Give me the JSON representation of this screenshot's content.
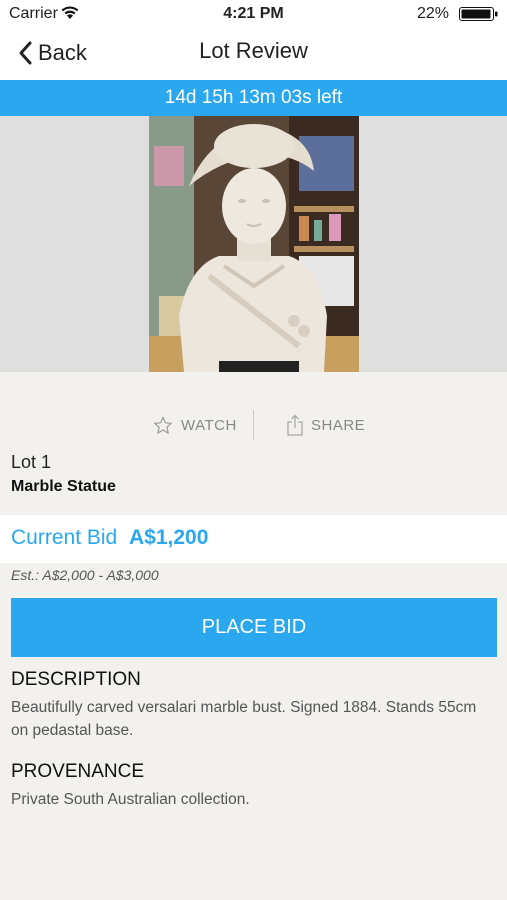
{
  "status_bar": {
    "carrier": "Carrier",
    "time": "4:21 PM",
    "battery": "22%"
  },
  "nav": {
    "back_label": "Back",
    "title": "Lot Review"
  },
  "timer": {
    "text": "14d 15h 13m 03s left"
  },
  "actions": {
    "watch_label": "WATCH",
    "share_label": "SHARE"
  },
  "lot": {
    "number": "Lot 1",
    "name": "Marble Statue"
  },
  "bid": {
    "label": "Current Bid",
    "amount": "A$1,200",
    "estimate": "Est.: A$2,000 - A$3,000",
    "button_label": "PLACE BID"
  },
  "description": {
    "heading": "DESCRIPTION",
    "text": "Beautifully carved versalari marble bust. Signed 1884. Stands 55cm on pedastal base."
  },
  "provenance": {
    "heading": "PROVENANCE",
    "text": "Private South Australian collection."
  },
  "colors": {
    "accent": "#2aa7ef",
    "background": "#f3f1ed"
  }
}
